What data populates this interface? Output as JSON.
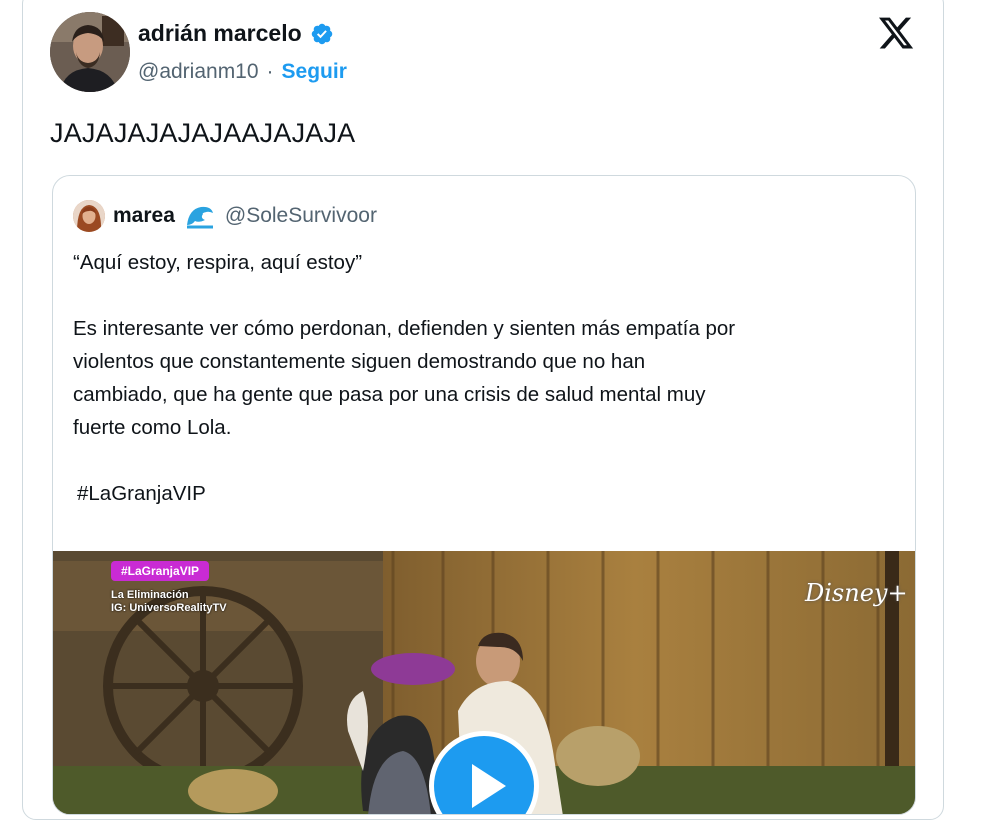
{
  "author": {
    "display_name": "adrián marcelo",
    "handle": "@adrianm10",
    "separator": "·",
    "follow_label": "Seguir"
  },
  "tweet": {
    "text": "JAJAJAJAJAJAAJAJAJA"
  },
  "quoted": {
    "display_name": "marea",
    "handle": "@SoleSurvivoor",
    "lines": [
      "“Aquí estoy, respira, aquí estoy”",
      "",
      "Es interesante ver cómo perdonan, defienden y sienten más empatía por",
      "violentos que constantemente siguen demostrando que no han",
      "cambiado, que ha gente que pasa por una crisis de salud mental muy",
      "fuerte como Lola.",
      "",
      " #LaGranjaVIP"
    ],
    "media": {
      "badge": "#LaGranjaVIP",
      "sub_line1": "La Eliminación",
      "sub_line2": "IG: UniversoRealityTV",
      "watermark": "Disney+"
    }
  },
  "colors": {
    "accent": "#1d9bf0",
    "text": "#0f1419",
    "muted": "#536471",
    "border": "#cfd9de"
  },
  "icons": [
    "verified-badge-icon",
    "x-logo-icon",
    "wave-emoji-icon",
    "play-icon"
  ]
}
